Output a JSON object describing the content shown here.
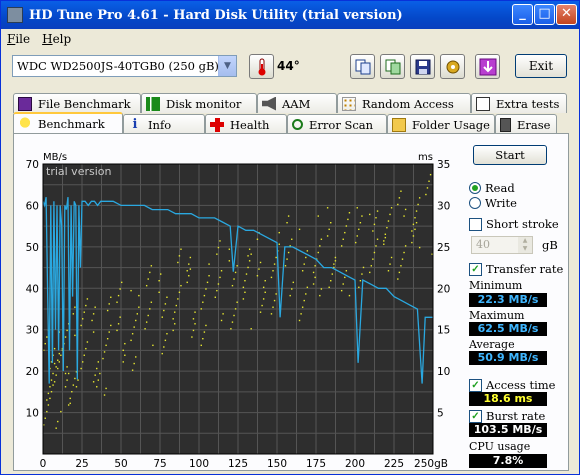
{
  "window": {
    "title": "HD Tune Pro 4.61 - Hard Disk Utility (trial version)"
  },
  "menu": [
    {
      "label": "File",
      "accel": "F"
    },
    {
      "label": "Help",
      "accel": "H"
    }
  ],
  "toolbar": {
    "drive": "WDC WD2500JS-40TGB0 (250 gB)",
    "temperature": "44°",
    "exit_label": "Exit"
  },
  "tabs_top": [
    "File Benchmark",
    "Disk monitor",
    "AAM",
    "Random Access",
    "Extra tests"
  ],
  "tabs_bottom": [
    "Benchmark",
    "Info",
    "Health",
    "Error Scan",
    "Folder Usage",
    "Erase"
  ],
  "side": {
    "start_label": "Start",
    "read_label": "Read",
    "write_label": "Write",
    "short_stroke_label": "Short stroke",
    "short_stroke_value": "40",
    "short_stroke_unit": "gB",
    "transfer_rate_label": "Transfer rate",
    "minimum_label": "Minimum",
    "minimum_value": "22.3 MB/s",
    "maximum_label": "Maximum",
    "maximum_value": "62.5 MB/s",
    "average_label": "Average",
    "average_value": "50.9 MB/s",
    "access_time_label": "Access time",
    "access_time_value": "18.6 ms",
    "burst_rate_label": "Burst rate",
    "burst_rate_value": "103.5 MB/s",
    "cpu_label": "CPU usage",
    "cpu_value": "7.8%"
  },
  "colors": {
    "transfer_line": "#2aa8e0",
    "access_dots": "#e8e830",
    "plot_bg": "#2e2e2e",
    "grid": "#555555"
  },
  "chart_data": {
    "type": "line",
    "watermark": "trial version",
    "left_unit": "MB/s",
    "right_unit": "ms",
    "x_ticks": [
      "0",
      "25",
      "50",
      "75",
      "100",
      "125",
      "150",
      "175",
      "200",
      "225",
      "250gB"
    ],
    "y_left_ticks": [
      "10",
      "20",
      "30",
      "40",
      "50",
      "60",
      "70"
    ],
    "y_right_ticks": [
      "5",
      "10",
      "15",
      "20",
      "25",
      "30",
      "35"
    ],
    "xlim": [
      0,
      250
    ],
    "ylim_left": [
      0,
      70
    ],
    "ylim_right": [
      0,
      35
    ],
    "grid": true,
    "series": [
      {
        "unit": "MB/s",
        "x": [
          0,
          1,
          2,
          3,
          4,
          5,
          6,
          7,
          8,
          9,
          10,
          11,
          12,
          13,
          14,
          15,
          16,
          17,
          18,
          19,
          20,
          21,
          22,
          23,
          24,
          25,
          27,
          29,
          31,
          33,
          35,
          37,
          40,
          45,
          50,
          55,
          60,
          65,
          70,
          75,
          80,
          85,
          90,
          95,
          100,
          105,
          110,
          115,
          120,
          122,
          125,
          130,
          135,
          140,
          145,
          150,
          152,
          155,
          160,
          165,
          170,
          175,
          180,
          185,
          190,
          195,
          200,
          202,
          205,
          210,
          215,
          220,
          225,
          230,
          235,
          240,
          243,
          245,
          248,
          250
        ],
        "values": [
          61,
          60,
          62,
          38,
          17,
          60,
          22,
          61,
          30,
          60,
          25,
          60,
          55,
          20,
          60,
          59,
          62,
          25,
          60,
          38,
          61,
          60,
          18,
          60,
          45,
          61,
          61,
          60,
          61,
          61,
          60,
          61,
          61,
          61,
          60,
          60,
          60,
          60,
          59,
          59,
          59,
          58,
          58,
          58,
          57,
          57,
          57,
          56,
          55,
          44,
          55,
          54,
          54,
          53,
          52,
          51,
          33,
          50,
          50,
          49,
          48,
          47,
          45,
          45,
          44,
          43,
          42,
          22,
          42,
          41,
          40,
          40,
          38,
          37,
          36,
          35,
          17,
          33,
          33,
          33
        ]
      },
      {
        "unit": "ms",
        "type": "scatter",
        "x": [
          1,
          2,
          3,
          5,
          7,
          9,
          12,
          15,
          18,
          20,
          24,
          28,
          32,
          36,
          40,
          45,
          50,
          55,
          60,
          65,
          70,
          75,
          80,
          85,
          90,
          95,
          100,
          105,
          110,
          115,
          120,
          125,
          130,
          135,
          140,
          145,
          150,
          155,
          160,
          165,
          170,
          175,
          180,
          185,
          190,
          195,
          200,
          205,
          210,
          215,
          220,
          225,
          230,
          235,
          240,
          245
        ],
        "values": [
          6,
          9,
          11,
          8,
          10,
          12,
          9,
          11,
          13,
          10,
          12,
          14,
          13,
          12,
          14,
          15,
          16,
          15,
          17,
          16,
          18,
          17,
          19,
          18,
          20,
          19,
          18,
          20,
          19,
          21,
          20,
          22,
          21,
          20,
          22,
          21,
          23,
          22,
          24,
          21,
          23,
          22,
          24,
          25,
          23,
          26,
          24,
          25,
          26,
          27,
          25,
          27,
          26,
          28,
          27,
          29
        ]
      }
    ]
  }
}
